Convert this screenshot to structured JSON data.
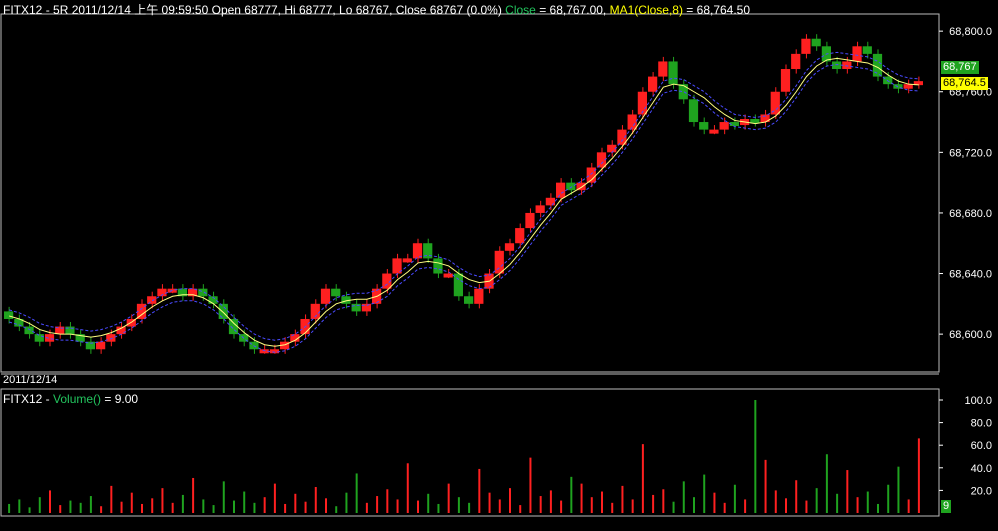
{
  "header": {
    "symbol": "FITX12",
    "period_date": "- 5R 2011/12/14 上午 09:59:50",
    "ohlc": "Open 68777, Hi 68777, Lo 68767, Close 68767 (0.0%)",
    "close_label": "Close",
    "close_value": " = 68,767.00,",
    "ma_label": "MA1(Close,8)",
    "ma_value": " = 68,764.50"
  },
  "date_label": "2011/12/14",
  "volume_header": {
    "symbol": "FITX12 -",
    "label": "Volume()",
    "value": " = 9.00"
  },
  "price_tag_close": "68,767",
  "price_tag_ma": "68,764.5",
  "volume_tag": "9",
  "colors": {
    "up": "#ff2020",
    "down": "#1fa31f",
    "ma": "#ffff80",
    "band": "#4a4aff",
    "close_text": "#22c55e",
    "ma_text": "#ffff00"
  },
  "chart_data": [
    {
      "type": "candlestick",
      "title": "FITX12 - 5R 2011/12/14",
      "ylim": [
        68575,
        68810
      ],
      "yticks": [
        68600,
        68640,
        68680,
        68720,
        68760,
        68800
      ],
      "ytick_labels": [
        "68,600.0",
        "68,640.0",
        "68,680.0",
        "68,720.0",
        "68,760.0",
        "68,800.0"
      ],
      "close": [
        68610,
        68605,
        68600,
        68595,
        68600,
        68605,
        68600,
        68595,
        68590,
        68595,
        68600,
        68605,
        68610,
        68620,
        68625,
        68630,
        68630,
        68625,
        68630,
        68625,
        68620,
        68610,
        68600,
        68595,
        68590,
        68590,
        68590,
        68595,
        68600,
        68610,
        68620,
        68630,
        68625,
        68620,
        68615,
        68620,
        68630,
        68640,
        68650,
        68650,
        68660,
        68650,
        68640,
        68640,
        68625,
        68620,
        68630,
        68640,
        68655,
        68660,
        68670,
        68680,
        68685,
        68690,
        68700,
        68695,
        68700,
        68710,
        68720,
        68725,
        68735,
        68745,
        68760,
        68770,
        68780,
        68765,
        68755,
        68740,
        68735,
        68735,
        68740,
        68738,
        68742,
        68740,
        68745,
        68760,
        68775,
        68785,
        68795,
        68790,
        68780,
        68775,
        68780,
        68790,
        68785,
        68770,
        68765,
        68762,
        68765,
        68767
      ],
      "ma_values": [
        68612,
        68610,
        68607,
        68603,
        68601,
        68600,
        68600,
        68599,
        68598,
        68599,
        68601,
        68604,
        68608,
        68613,
        68618,
        68622,
        68625,
        68626,
        68626,
        68624,
        68620,
        68614,
        68607,
        68601,
        68596,
        68593,
        68592,
        68593,
        68596,
        68601,
        68608,
        68615,
        68620,
        68622,
        68623,
        68623,
        68625,
        68629,
        68636,
        68641,
        68647,
        68648,
        68647,
        68645,
        68640,
        68636,
        68634,
        68635,
        68640,
        68646,
        68654,
        68663,
        68672,
        68680,
        68689,
        68693,
        68697,
        68702,
        68709,
        68716,
        68724,
        68733,
        68743,
        68753,
        68763,
        68765,
        68764,
        68760,
        68756,
        68750,
        68745,
        68741,
        68740,
        68739,
        68740,
        68744,
        68751,
        68760,
        68770,
        68777,
        68781,
        68782,
        68781,
        68780,
        68779,
        68776,
        68771,
        68767,
        68765,
        68764.5
      ],
      "volume": [
        8,
        12,
        5,
        14,
        20,
        7,
        11,
        9,
        15,
        6,
        24,
        10,
        18,
        8,
        13,
        22,
        9,
        16,
        31,
        12,
        7,
        28,
        11,
        19,
        9,
        14,
        26,
        8,
        17,
        10,
        23,
        13,
        6,
        18,
        35,
        9,
        15,
        21,
        12,
        44,
        11,
        17,
        8,
        26,
        14,
        9,
        39,
        18,
        12,
        22,
        7,
        49,
        15,
        20,
        11,
        32,
        26,
        14,
        19,
        9,
        24,
        12,
        61,
        16,
        21,
        10,
        28,
        14,
        34,
        18,
        9,
        25,
        12,
        100,
        47,
        20,
        13,
        29,
        11,
        22,
        52,
        17,
        38,
        14,
        19,
        8,
        25,
        41,
        12,
        66
      ]
    }
  ]
}
